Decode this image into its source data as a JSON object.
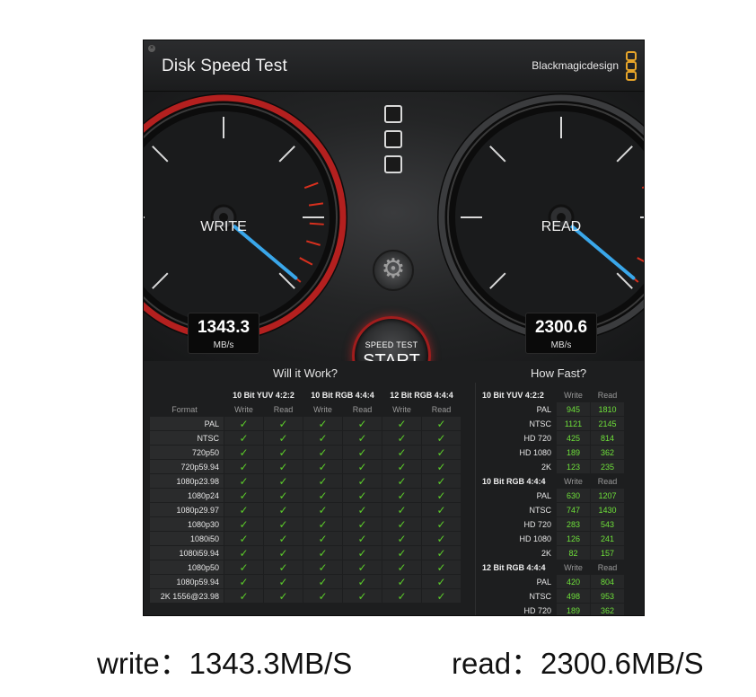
{
  "window": {
    "title": "Disk Speed Test",
    "brand": "Blackmagicdesign"
  },
  "gauges": {
    "write": {
      "label": "WRITE",
      "value": "1343.3",
      "unit": "MB/s"
    },
    "read": {
      "label": "READ",
      "value": "2300.6",
      "unit": "MB/s"
    }
  },
  "start_button": {
    "small": "SPEED TEST",
    "big": "START"
  },
  "will_it_work": {
    "title": "Will it Work?",
    "groups": [
      "10 Bit YUV 4:2:2",
      "10 Bit RGB 4:4:4",
      "12 Bit RGB 4:4:4"
    ],
    "format_header": "Format",
    "write_label": "Write",
    "read_label": "Read",
    "check_symbol": "✓",
    "rows": [
      "PAL",
      "NTSC",
      "720p50",
      "720p59.94",
      "1080p23.98",
      "1080p24",
      "1080p29.97",
      "1080p30",
      "1080i50",
      "1080i59.94",
      "1080p50",
      "1080p59.94",
      "2K 1556@23.98"
    ]
  },
  "how_fast": {
    "title": "How Fast?",
    "write_label": "Write",
    "read_label": "Read",
    "groups": [
      {
        "name": "10 Bit YUV 4:2:2",
        "rows": [
          {
            "label": "PAL",
            "write": "945",
            "read": "1810"
          },
          {
            "label": "NTSC",
            "write": "1121",
            "read": "2145"
          },
          {
            "label": "HD 720",
            "write": "425",
            "read": "814"
          },
          {
            "label": "HD 1080",
            "write": "189",
            "read": "362"
          },
          {
            "label": "2K",
            "write": "123",
            "read": "235"
          }
        ]
      },
      {
        "name": "10 Bit RGB 4:4:4",
        "rows": [
          {
            "label": "PAL",
            "write": "630",
            "read": "1207"
          },
          {
            "label": "NTSC",
            "write": "747",
            "read": "1430"
          },
          {
            "label": "HD 720",
            "write": "283",
            "read": "543"
          },
          {
            "label": "HD 1080",
            "write": "126",
            "read": "241"
          },
          {
            "label": "2K",
            "write": "82",
            "read": "157"
          }
        ]
      },
      {
        "name": "12 Bit RGB 4:4:4",
        "rows": [
          {
            "label": "PAL",
            "write": "420",
            "read": "804"
          },
          {
            "label": "NTSC",
            "write": "498",
            "read": "953"
          },
          {
            "label": "HD 720",
            "write": "189",
            "read": "362"
          }
        ]
      }
    ]
  },
  "captions": {
    "write": "write：1343.3MB/S",
    "read": "read：2300.6MB/S"
  },
  "colors": {
    "write_ring": "#b4201f",
    "needle": "#3aa7ea",
    "check": "#5ccd2a",
    "speed_value": "#6ee03a",
    "redline": "#d8301e"
  }
}
